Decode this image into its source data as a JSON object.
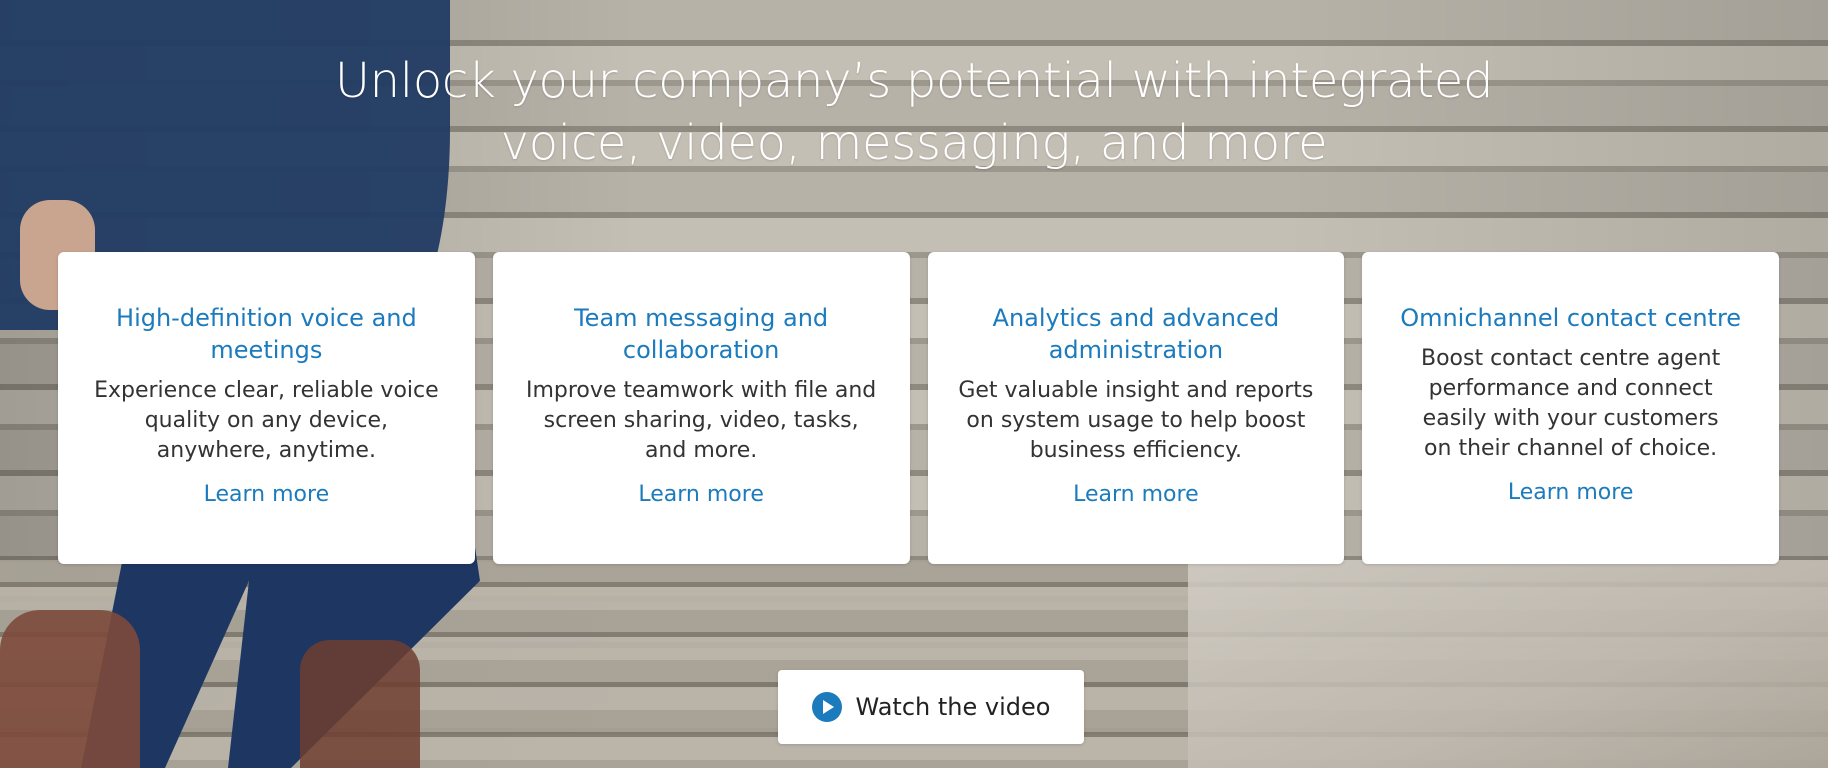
{
  "headline": {
    "line1": "Unlock your company’s potential with integrated",
    "line2": "voice, video, messaging, and more"
  },
  "cards": [
    {
      "title": "High-definition voice and meetings",
      "description": "Experience clear, reliable voice quality on any device, anywhere, anytime.",
      "link": "Learn more"
    },
    {
      "title": "Team messaging and collaboration",
      "description": "Improve teamwork with file and screen sharing, video, tasks, and more.",
      "link": "Learn more"
    },
    {
      "title": "Analytics and advanced administration",
      "description": "Get valuable insight and reports on system usage to help boost business efficiency.",
      "link": "Learn more"
    },
    {
      "title": "Omnichannel contact centre",
      "description": "Boost contact centre agent performance and connect easily with your customers on their channel of choice.",
      "link": "Learn more"
    }
  ],
  "video_button": {
    "label": "Watch the video",
    "icon": "play-circle-icon"
  },
  "colors": {
    "accent": "#1b7bbd",
    "card_background": "#ffffff",
    "headline_text": "#ffffff"
  }
}
